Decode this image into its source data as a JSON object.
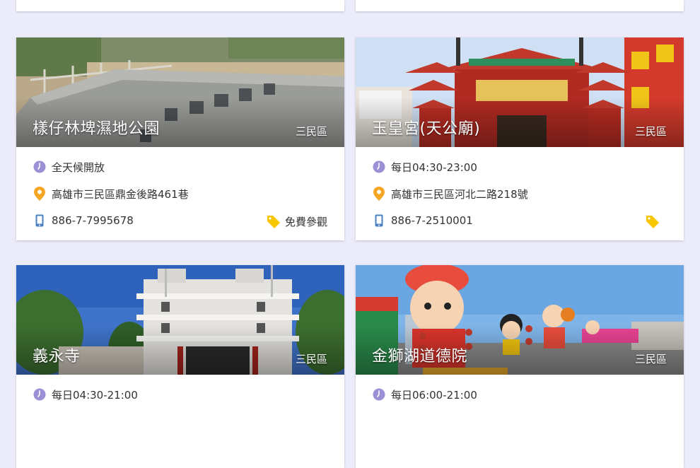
{
  "cards": [
    {
      "title": "樣仔林埤濕地公園",
      "district": "三民區",
      "hours": "全天候開放",
      "address": "高雄市三民區鼎金後路461巷",
      "phone": "886-7-7995678",
      "ticket": "免費參觀"
    },
    {
      "title": "玉皇宮(天公廟)",
      "district": "三民區",
      "hours": "每日04:30-23:00",
      "address": "高雄市三民區河北二路218號",
      "phone": "886-7-2510001",
      "ticket": ""
    },
    {
      "title": "義永寺",
      "district": "三民區",
      "hours": "每日04:30-21:00"
    },
    {
      "title": "金獅湖道德院",
      "district": "三民區",
      "hours": "每日06:00-21:00"
    }
  ],
  "icons": {
    "clock": "clock-icon",
    "pin": "map-pin-icon",
    "phone": "phone-icon",
    "tag": "tag-icon"
  },
  "colors": {
    "background": "#ebebfa",
    "clock": "#9b8fd6",
    "pin": "#f5a623",
    "phone": "#4a7fc1",
    "tag": "#f7c600"
  }
}
